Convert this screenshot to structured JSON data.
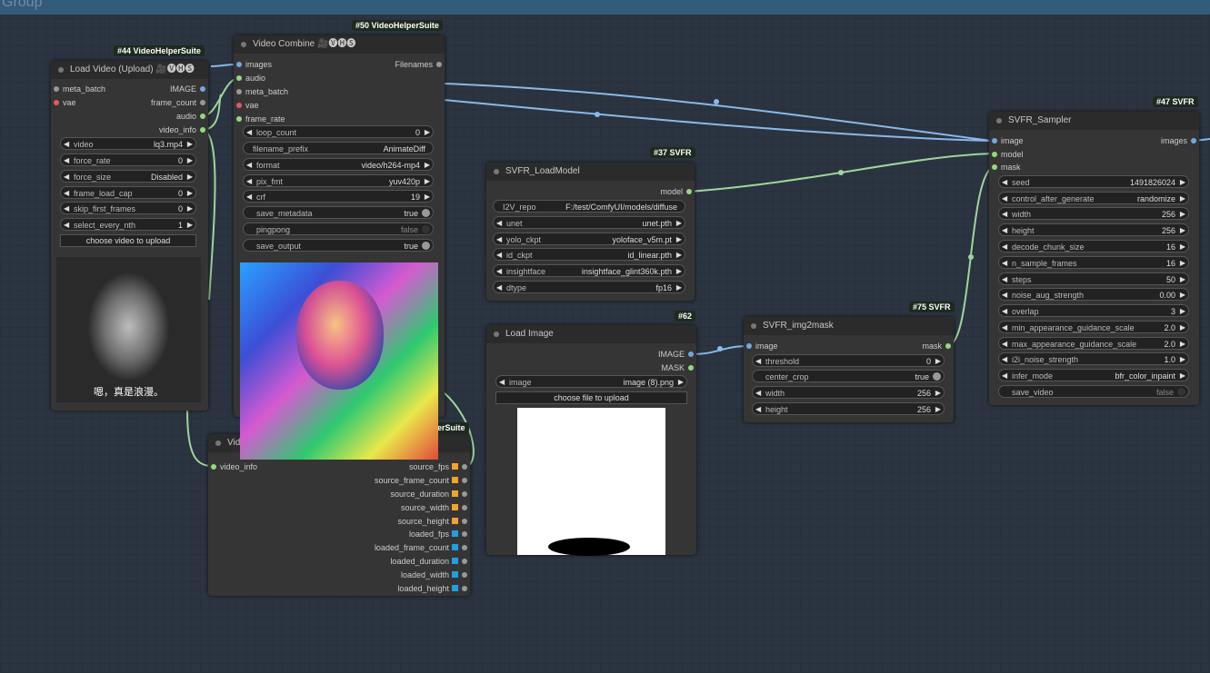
{
  "group": {
    "label": "Group"
  },
  "colors": {
    "link_blue": "#8ab9ea",
    "link_green": "#9fd69a",
    "slot_blue": "#73a7e0",
    "slot_green": "#95d880",
    "slot_red": "#e35b5b",
    "slot_grey": "#999999",
    "orange": "#f2a32f",
    "sky": "#1ea0e2"
  },
  "n44": {
    "badge": "#44 VideoHelperSuite",
    "title": "Load Video (Upload) 🎥🅥🅗🅢",
    "in": [
      "meta_batch",
      "vae"
    ],
    "out": [
      "IMAGE",
      "frame_count",
      "audio",
      "video_info"
    ],
    "w": [
      {
        "l": "video",
        "v": "lq3.mp4"
      },
      {
        "l": "force_rate",
        "v": "0"
      },
      {
        "l": "force_size",
        "v": "Disabled"
      },
      {
        "l": "frame_load_cap",
        "v": "0"
      },
      {
        "l": "skip_first_frames",
        "v": "0"
      },
      {
        "l": "select_every_nth",
        "v": "1"
      }
    ],
    "upload": "choose video to upload",
    "caption": "嗯，真是浪漫。"
  },
  "n50": {
    "badge": "#50 VideoHelperSuite",
    "title": "Video Combine 🎥🅥🅗🅢",
    "in": [
      "images",
      "audio",
      "meta_batch",
      "vae",
      "frame_rate"
    ],
    "out": [
      "Filenames"
    ],
    "w": [
      {
        "l": "loop_count",
        "v": "0"
      },
      {
        "l": "filename_prefix",
        "v": "AnimateDiff"
      },
      {
        "l": "format",
        "v": "video/h264-mp4"
      },
      {
        "l": "pix_fmt",
        "v": "yuv420p"
      },
      {
        "l": "crf",
        "v": "19"
      },
      {
        "l": "save_metadata",
        "v": "true"
      },
      {
        "l": "pingpong",
        "v": "false"
      },
      {
        "l": "save_output",
        "v": "true"
      }
    ]
  },
  "ninfo": {
    "title": "Vid",
    "badge": "erSuite",
    "in": "video_info",
    "out": [
      "source_fps",
      "source_frame_count",
      "source_duration",
      "source_width",
      "source_height",
      "loaded_fps",
      "loaded_frame_count",
      "loaded_duration",
      "loaded_width",
      "loaded_height"
    ]
  },
  "n37": {
    "badge": "#37 SVFR",
    "title": "SVFR_LoadModel",
    "out": "model",
    "w": [
      {
        "l": "I2V_repo",
        "v": "F:/test/ComfyUI/models/diffuse"
      },
      {
        "l": "unet",
        "v": "unet.pth"
      },
      {
        "l": "yolo_ckpt",
        "v": "yoloface_v5m.pt"
      },
      {
        "l": "id_ckpt",
        "v": "id_linear.pth"
      },
      {
        "l": "insightface",
        "v": "insightface_glint360k.pth"
      },
      {
        "l": "dtype",
        "v": "fp16"
      }
    ]
  },
  "n62": {
    "badge": "#62",
    "title": "Load Image",
    "out": [
      "IMAGE",
      "MASK"
    ],
    "w": {
      "l": "image",
      "v": "image (8).png"
    },
    "upload": "choose file to upload"
  },
  "n75": {
    "badge": "#75 SVFR",
    "title": "SVFR_img2mask",
    "in": "image",
    "out": "mask",
    "w": [
      {
        "l": "threshold",
        "v": "0"
      },
      {
        "l": "center_crop",
        "v": "true"
      },
      {
        "l": "width",
        "v": "256"
      },
      {
        "l": "height",
        "v": "256"
      }
    ]
  },
  "n47": {
    "badge": "#47 SVFR",
    "title": "SVFR_Sampler",
    "in": [
      "image",
      "model",
      "mask"
    ],
    "out": "images",
    "w": [
      {
        "l": "seed",
        "v": "1491826024"
      },
      {
        "l": "control_after_generate",
        "v": "randomize"
      },
      {
        "l": "width",
        "v": "256"
      },
      {
        "l": "height",
        "v": "256"
      },
      {
        "l": "decode_chunk_size",
        "v": "16"
      },
      {
        "l": "n_sample_frames",
        "v": "16"
      },
      {
        "l": "steps",
        "v": "50"
      },
      {
        "l": "noise_aug_strength",
        "v": "0.00"
      },
      {
        "l": "overlap",
        "v": "3"
      },
      {
        "l": "min_appearance_guidance_scale",
        "v": "2.0"
      },
      {
        "l": "max_appearance_guidance_scale",
        "v": "2.0"
      },
      {
        "l": "i2i_noise_strength",
        "v": "1.0"
      },
      {
        "l": "infer_mode",
        "v": "bfr_color_inpaint"
      },
      {
        "l": "save_video",
        "v": "false"
      }
    ]
  }
}
